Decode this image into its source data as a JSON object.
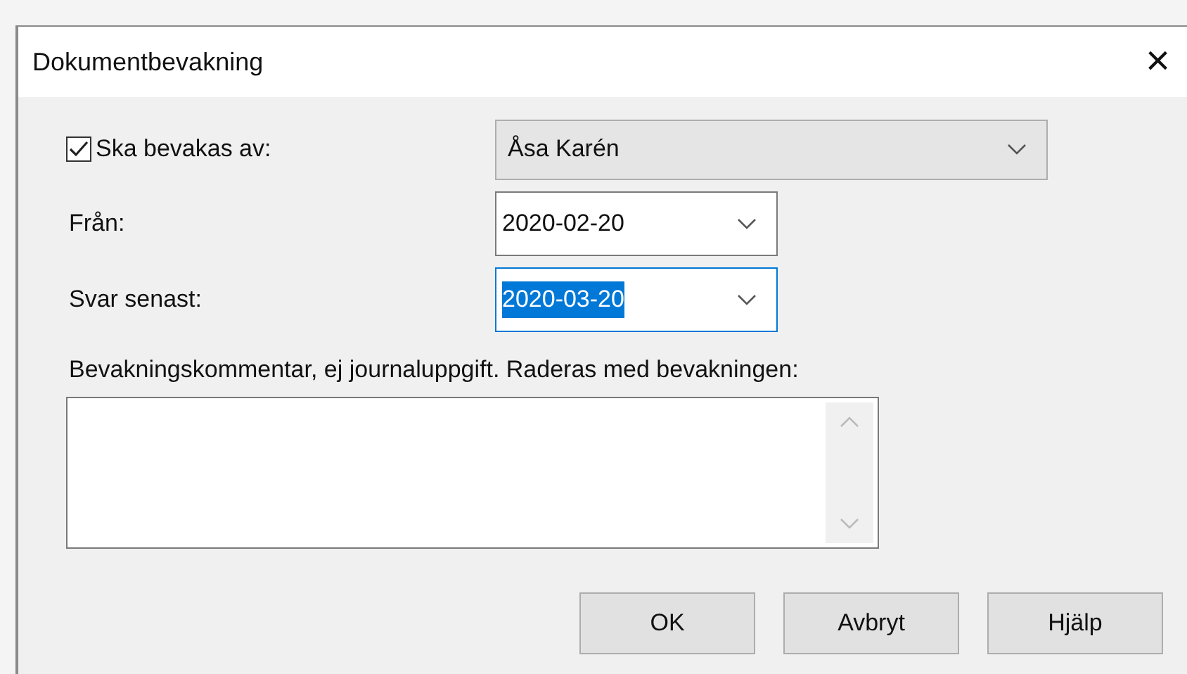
{
  "window": {
    "title": "Dokumentbevakning",
    "close": "×"
  },
  "watcher": {
    "label": "Ska bevakas av:",
    "checked": true,
    "value": "Åsa Karén"
  },
  "dates": [
    {
      "label": "Från:",
      "value": "2020-02-20",
      "selected": false
    },
    {
      "label": "Svar senast:",
      "value": "2020-03-20",
      "selected": true
    }
  ],
  "comment": {
    "label": "Bevakningskommentar, ej journaluppgift. Raderas med bevakningen:"
  },
  "buttons": [
    "OK",
    "Avbryt",
    "Hjälp"
  ]
}
